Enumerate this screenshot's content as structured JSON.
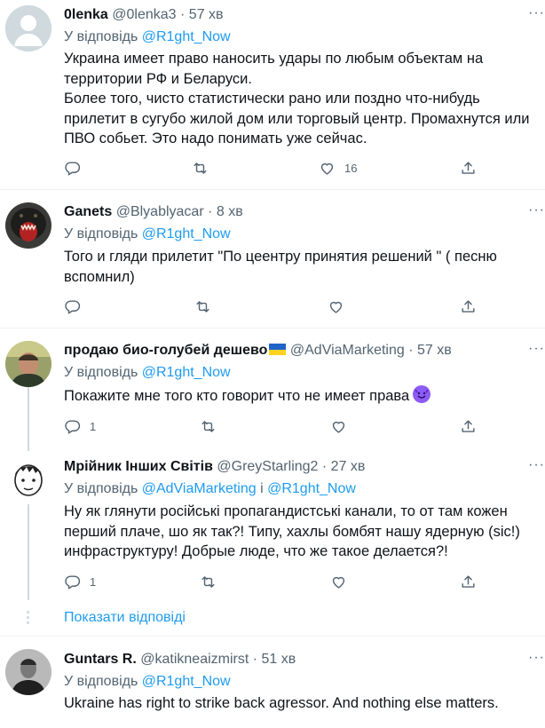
{
  "tweets": [
    {
      "name": "0lenka",
      "handle": "@0lenka3",
      "dot": "·",
      "time": "57 хв",
      "reply_prefix": "У відповідь ",
      "reply_to": "@R1ght_Now",
      "reply_join": "",
      "reply_to2": "",
      "text": "Украина имеет право наносить удары по любым объектам на территории РФ и Беларуси.\nБолее того, чисто статистически рано или поздно что-нибудь прилетит в сугубо жилой дом или торговый центр. Промахнутся или ПВО собьет. Это надо понимать уже сейчас.",
      "reply_count": "",
      "retweet_count": "",
      "like_count": "16"
    },
    {
      "name": "Ganets",
      "handle": "@Blyablyacar",
      "dot": "·",
      "time": "8 хв",
      "reply_prefix": "У відповідь ",
      "reply_to": "@R1ght_Now",
      "reply_join": "",
      "reply_to2": "",
      "text": "Того и гляди прилетит \"По цеентру принятия решений \" ( песню вспомнил)",
      "reply_count": "",
      "retweet_count": "",
      "like_count": ""
    },
    {
      "name": "продаю био-голубей дешево",
      "handle": "@AdViaMarketing",
      "dot": "·",
      "time": "57 хв",
      "reply_prefix": "У відповідь ",
      "reply_to": "@R1ght_Now",
      "reply_join": "",
      "reply_to2": "",
      "text": "Покажите мне того кто говорит что не имеет права",
      "reply_count": "1",
      "retweet_count": "",
      "like_count": ""
    },
    {
      "name": "Мрійник Інших Світів",
      "handle": "@GreyStarling2",
      "dot": "·",
      "time": "27 хв",
      "reply_prefix": "У відповідь ",
      "reply_to": "@AdViaMarketing",
      "reply_join": " і ",
      "reply_to2": "@R1ght_Now",
      "text": "Ну як глянути російські пропагандистські канали, то от там кожен перший плаче, шо як так?! Типу, хахлы бомбят нашу ядерную (sic!) инфраструктуру! Добрые люде, что же такое делается?!",
      "reply_count": "1",
      "retweet_count": "",
      "like_count": ""
    },
    {
      "name": "Guntars R.",
      "handle": "@katikneaizmirst",
      "dot": "·",
      "time": "51 хв",
      "reply_prefix": "У відповідь ",
      "reply_to": "@R1ght_Now",
      "reply_join": "",
      "reply_to2": "",
      "text": "Ukraine has right to strike back agressor. And nothing else matters.",
      "reply_count": "",
      "retweet_count": "",
      "like_count": ""
    }
  ],
  "show_replies": "Показати відповіді",
  "more_label": "···",
  "colors": {
    "accent": "#1d9bf0",
    "muted": "#536471",
    "text": "#0f1419"
  }
}
